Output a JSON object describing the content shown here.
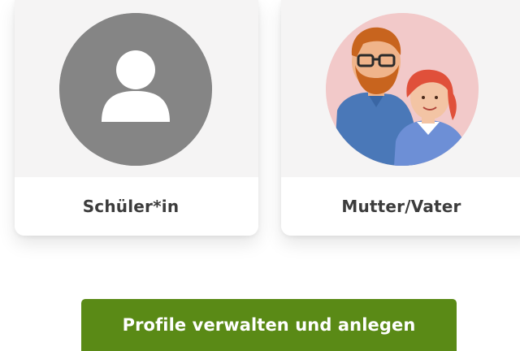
{
  "profiles": [
    {
      "label": "Schüler*in",
      "icon": "person-silhouette-icon"
    },
    {
      "label": "Mutter/Vater",
      "icon": "parents-illustration-icon"
    }
  ],
  "actions": {
    "manage_label": "Profile verwalten und anlegen"
  },
  "colors": {
    "accent_green": "#5a8a16",
    "avatar_grey": "#858585",
    "card_top_bg": "#f5f4f4"
  }
}
